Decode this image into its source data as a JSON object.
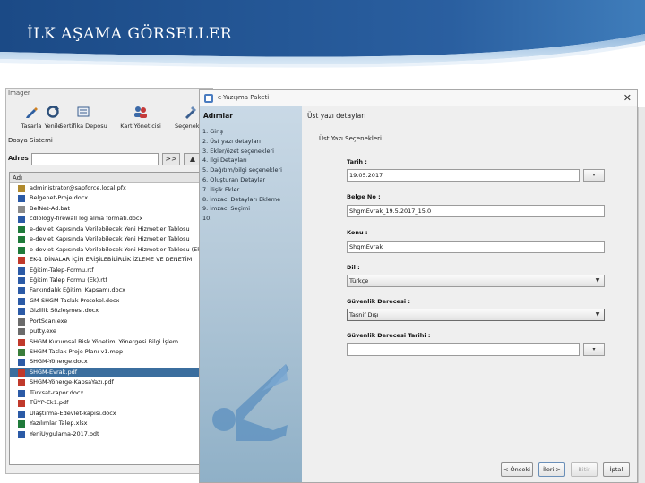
{
  "slide": {
    "title": "İLK AŞAMA GÖRSELLER"
  },
  "bg_window": {
    "title": "Imager",
    "toolbar": [
      {
        "label": "Tasarla",
        "icon": "pencil-icon"
      },
      {
        "label": "Yenile",
        "icon": "refresh-icon"
      },
      {
        "label": "Sertifika Deposu",
        "icon": "certificate-icon"
      },
      {
        "label": "Kart Yöneticisi",
        "icon": "card-icon"
      },
      {
        "label": "Seçenekler",
        "icon": "tools-icon"
      }
    ],
    "menu_label": "Dosya Sistemi",
    "address_label": "Adres :",
    "address_value": "",
    "go_button": ">>",
    "up_button": "▲",
    "list_header": "Adı",
    "files": [
      {
        "name": "administrator@sapforce.local.pfx",
        "type": "cert"
      },
      {
        "name": "Belgenet-Proje.docx",
        "type": "doc"
      },
      {
        "name": "BelNet-Ad.bat",
        "type": "file"
      },
      {
        "name": "cdlology-firewall log alma formatı.docx",
        "type": "doc"
      },
      {
        "name": "e-devlet Kapısında Verilebilecek Yeni Hizmetler Tablosu",
        "type": "xls"
      },
      {
        "name": "e-devlet Kapısında Verilebilecek Yeni Hizmetler Tablosu",
        "type": "xls"
      },
      {
        "name": "e-devlet Kapısında Verilebilecek Yeni Hizmetler Tablosu (Ek-1).doc",
        "type": "xls"
      },
      {
        "name": "EK-1 DİNALAR İÇİN ERİŞİLEBİLİRLİK İZLEME VE DENETİM",
        "type": "pdf"
      },
      {
        "name": "Eğitim-Talep-Formu.rtf",
        "type": "doc"
      },
      {
        "name": "Eğitim Talep Formu (Ek).rtf",
        "type": "doc"
      },
      {
        "name": "Farkındalık Eğitimi Kapsamı.docx",
        "type": "doc"
      },
      {
        "name": "GM-SHGM Taslak Protokol.docx",
        "type": "doc"
      },
      {
        "name": "Gizlilik Sözleşmesi.docx",
        "type": "doc"
      },
      {
        "name": "PortScan.exe",
        "type": "exe"
      },
      {
        "name": "putty.exe",
        "type": "exe"
      },
      {
        "name": "SHGM Kurumsal Risk Yönetimi Yönergesi Bilgi İşlem",
        "type": "pdf"
      },
      {
        "name": "SHGM Taslak Proje Planı v1.mpp",
        "type": "mpp"
      },
      {
        "name": "SHGM-Yönerge.docx",
        "type": "doc"
      },
      {
        "name": "SHGM-Evrak.pdf",
        "type": "pdf"
      },
      {
        "name": "SHGM-Yönerge-KapsaYazı.pdf",
        "type": "pdf"
      },
      {
        "name": "Türksat-rapor.docx",
        "type": "doc"
      },
      {
        "name": "TÜYP-Ek1.pdf",
        "type": "pdf"
      },
      {
        "name": "Ulaştırma-Edevlet-kapısı.docx",
        "type": "doc"
      },
      {
        "name": "Yazılımlar Talep.xlsx",
        "type": "xls"
      },
      {
        "name": "YeniUygulama-2017.odt",
        "type": "doc"
      }
    ],
    "selected_index": 18
  },
  "wizard": {
    "title": "e-Yazışma Paketi",
    "close": "✕",
    "steps_header": "Adımlar",
    "steps": [
      "1. Giriş",
      "2. Üst yazı detayları",
      "3. Ekler/özet seçenekleri",
      "4. İlgi Detayları",
      "5. Dağıtım/bilgi seçenekleri",
      "6. Oluşturan Detaylar",
      "7. İlişik Ekler",
      "8. İmzacı Detayları Ekleme",
      "9. İmzacı Seçimi",
      "10."
    ],
    "main_header": "Üst yazı detayları",
    "section_title": "Üst Yazı Seçenekleri",
    "fields": {
      "tarih_label": "Tarih :",
      "tarih_value": "19.05.2017",
      "tarih_picker": "▾",
      "belge_no_label": "Belge No :",
      "belge_no_value": "ShgmEvrak_19.5.2017_15.0",
      "konu_label": "Konu :",
      "konu_value": "ShgmEvrak",
      "dil_label": "Dil :",
      "dil_value": "Türkçe",
      "guvenlik_label": "Güvenlik Derecesi :",
      "guvenlik_value": "Tasnif Dışı",
      "guvenlik_tarih_label": "Güvenlik Derecesi Tarihi :",
      "guvenlik_tarih_value": "",
      "guvenlik_tarih_picker": "▾"
    },
    "buttons": {
      "back": "< Önceki",
      "next": "İleri >",
      "finish": "Bitir",
      "cancel": "İptal"
    }
  },
  "colors": {
    "header_band": "#1f4f8f",
    "selection": "#3b6e9e",
    "wizard_panel": "#b3c8d8",
    "logo": "#5b8fbf"
  }
}
